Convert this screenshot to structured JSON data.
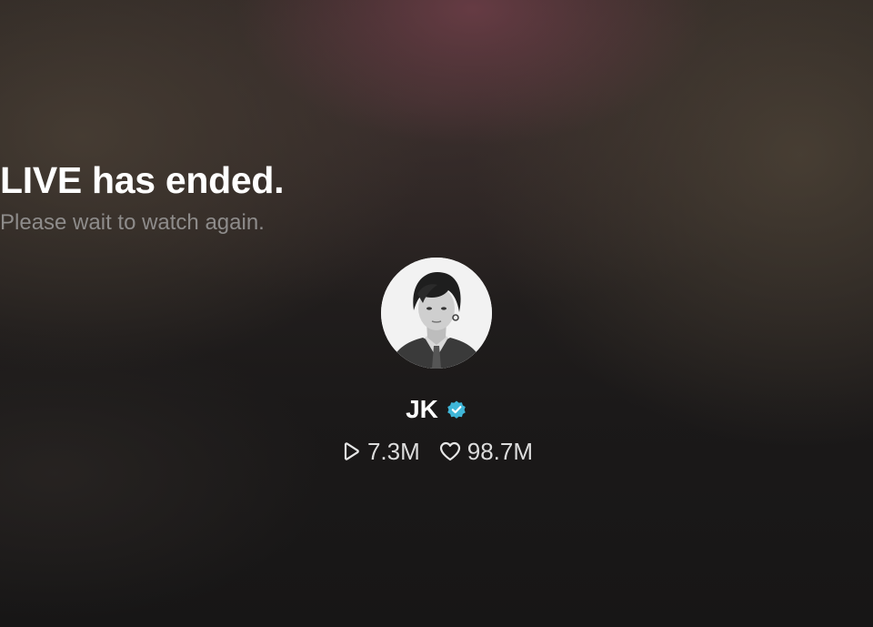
{
  "live_status": {
    "title": "LIVE has ended.",
    "subtitle": "Please wait to watch again."
  },
  "profile": {
    "name": "JK",
    "verified": true,
    "avatar_icon": "profile-photo"
  },
  "stats": {
    "plays": {
      "icon": "play-icon",
      "value": "7.3M"
    },
    "likes": {
      "icon": "heart-icon",
      "value": "98.7M"
    }
  },
  "colors": {
    "verified_badge": "#3fb6d8",
    "title_text": "#ffffff",
    "subtitle_text": "#8e8c8b"
  }
}
